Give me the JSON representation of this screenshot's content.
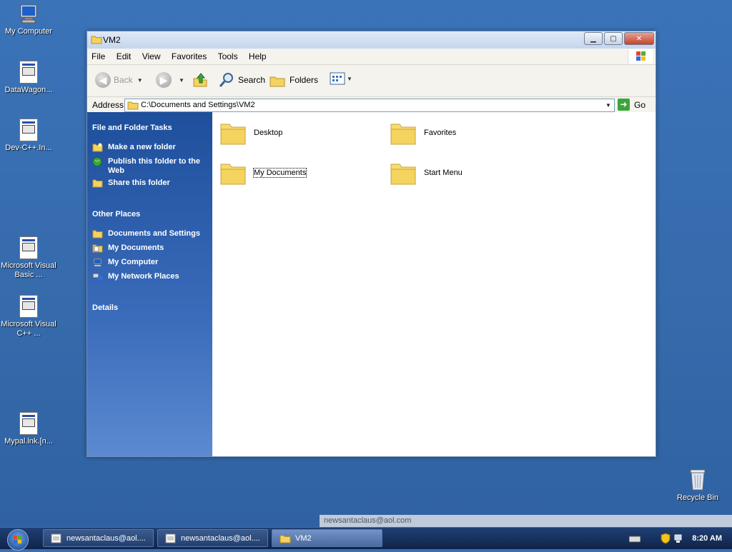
{
  "desktop": {
    "icons": [
      {
        "label": "My Computer"
      },
      {
        "label": "DataWagon..."
      },
      {
        "label": "Dev-C++.In..."
      },
      {
        "label": "Microsoft Visual Basic ..."
      },
      {
        "label": "Microsoft Visual C++ ..."
      },
      {
        "label": "Mypal.lnk.[n..."
      }
    ],
    "recycle_bin": "Recycle Bin",
    "ghost_text": "newsantaclaus@aol.com"
  },
  "window": {
    "title": "VM2",
    "menu": [
      "File",
      "Edit",
      "View",
      "Favorites",
      "Tools",
      "Help"
    ],
    "toolbar": {
      "back": "Back",
      "search": "Search",
      "folders": "Folders"
    },
    "address": {
      "label": "Address",
      "value": "C:\\Documents and Settings\\VM2",
      "go": "Go"
    },
    "taskpane": {
      "file_tasks_title": "File and Folder Tasks",
      "file_tasks": [
        "Make a new folder",
        "Publish this folder to the Web",
        "Share this folder"
      ],
      "other_places_title": "Other Places",
      "other_places": [
        "Documents and Settings",
        "My Documents",
        "My Computer",
        "My Network Places"
      ],
      "details_title": "Details"
    },
    "folders": [
      "Desktop",
      "Favorites",
      "My Documents",
      "Start Menu"
    ]
  },
  "taskbar": {
    "buttons": [
      "newsantaclaus@aol....",
      "newsantaclaus@aol....",
      "VM2"
    ],
    "clock": "8:20 AM"
  }
}
